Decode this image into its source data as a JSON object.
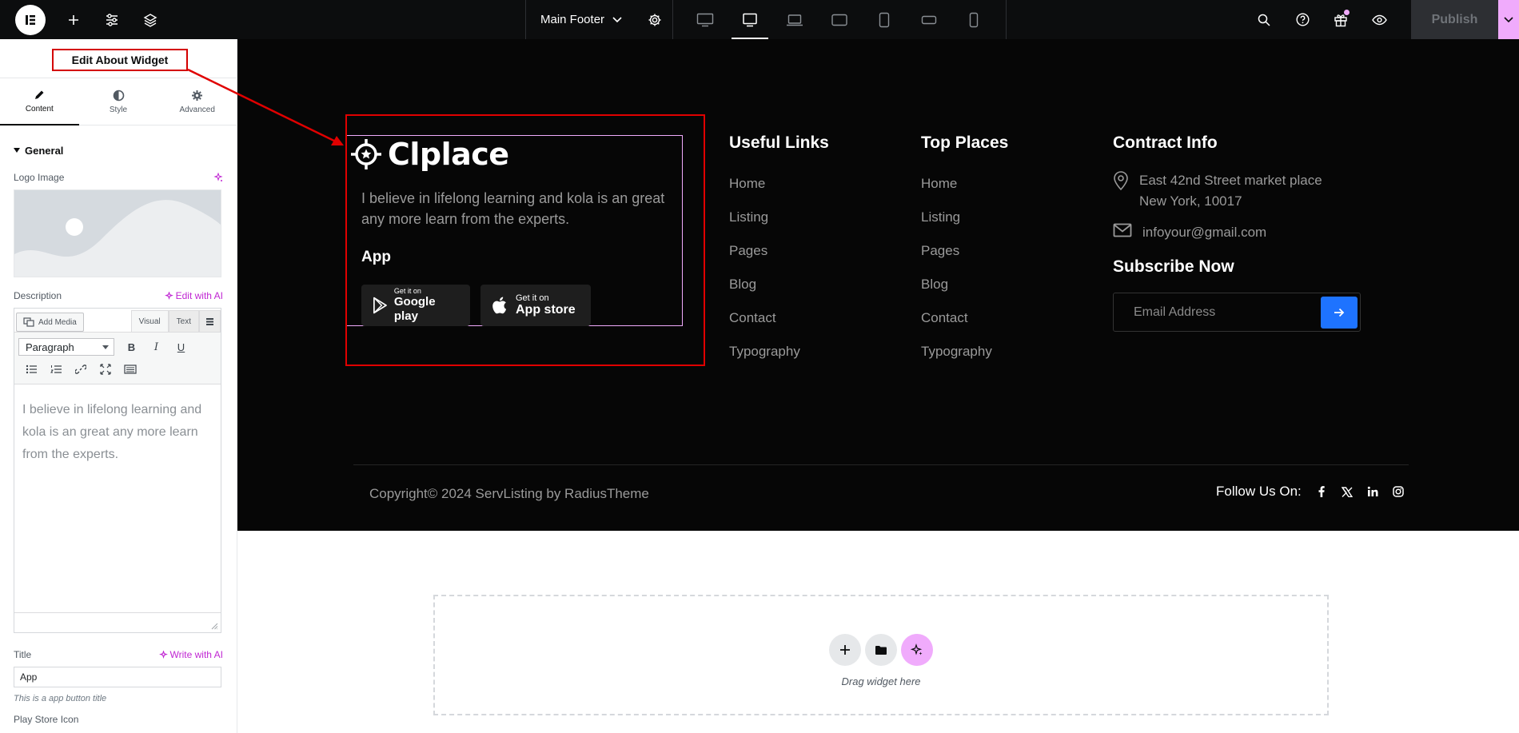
{
  "topbar": {
    "document_name": "Main Footer",
    "publish_label": "Publish",
    "devices": [
      "desktop",
      "tablet-landscape",
      "laptop",
      "tablet-extra",
      "tablet-portrait",
      "mobile-landscape",
      "mobile"
    ]
  },
  "panel": {
    "title": "Edit About Widget",
    "tabs": [
      {
        "label": "Content",
        "icon": "pencil-icon"
      },
      {
        "label": "Style",
        "icon": "contrast-icon"
      },
      {
        "label": "Advanced",
        "icon": "gear-icon"
      }
    ],
    "section_title": "General",
    "logo_label": "Logo Image",
    "description_label": "Description",
    "edit_ai": "Edit with AI",
    "add_media": "Add Media",
    "visual_tab": "Visual",
    "text_tab": "Text",
    "paragraph_select": "Paragraph",
    "editor_text": "I believe in lifelong learning and kola is an great any more learn from the experts.",
    "title_label": "Title",
    "write_ai": "Write with AI",
    "title_value": "App",
    "title_note": "This is a app button title",
    "next_label": "Play Store Icon"
  },
  "footer": {
    "brand": "Clplace",
    "about_text": "I believe in lifelong learning and kola is an great any more learn from the experts.",
    "app_title": "App",
    "google": {
      "small": "Get it on",
      "big": "Google play"
    },
    "apple": {
      "small": "Get it on",
      "big": "App store"
    },
    "useful_links": {
      "title": "Useful Links",
      "items": [
        "Home",
        "Listing",
        "Pages",
        "Blog",
        "Contact",
        "Typography"
      ]
    },
    "top_places": {
      "title": "Top Places",
      "items": [
        "Home",
        "Listing",
        "Pages",
        "Blog",
        "Contact",
        "Typography"
      ]
    },
    "contact": {
      "title": "Contract Info",
      "address_line1": "East 42nd Street market place",
      "address_line2": "New York, 10017",
      "email": "infoyour@gmail.com"
    },
    "subscribe": {
      "title": "Subscribe Now",
      "placeholder": "Email Address"
    },
    "copyright": "Copyright© 2024 ServListing by RadiusTheme",
    "follow_label": "Follow Us On:"
  },
  "dropzone": {
    "text": "Drag widget here"
  },
  "colors": {
    "accent_pink": "#f0abfc",
    "highlight_red": "#e00000",
    "subscribe_blue": "#1e73ff",
    "footer_bg": "#060606"
  }
}
